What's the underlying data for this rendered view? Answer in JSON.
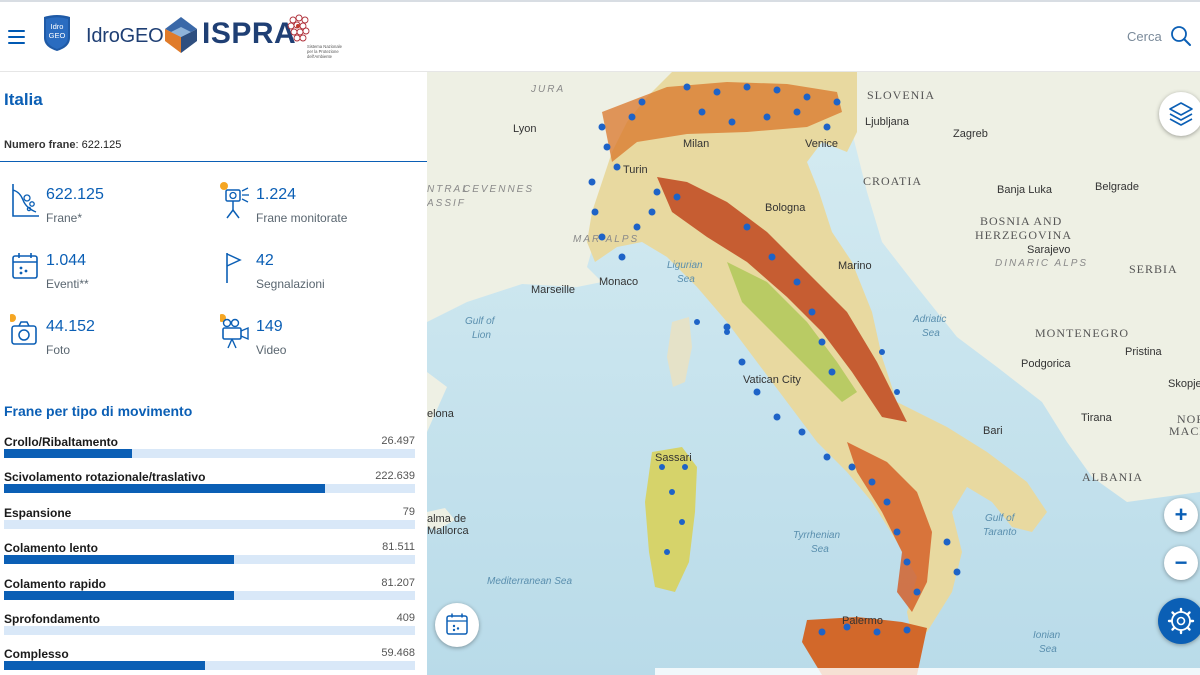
{
  "header": {
    "app_logo_text": "Idro GEO",
    "app_name": "IdroGEO",
    "org_name": "ISPRA",
    "snpa_text": "Sistema Nazionale per la Protezione dell'Ambiente",
    "search_label": "Cerca"
  },
  "panel": {
    "region_title": "Italia",
    "num_frane_label": "Numero frane",
    "num_frane_value": ": 622.125",
    "stats": [
      {
        "value": "622.125",
        "label": "Frane*",
        "icon": "landslide-icon"
      },
      {
        "value": "1.224",
        "label": "Frane monitorate",
        "icon": "monitoring-camera-icon"
      },
      {
        "value": "1.044",
        "label": "Eventi**",
        "icon": "calendar-icon"
      },
      {
        "value": "42",
        "label": "Segnalazioni",
        "icon": "flag-icon"
      },
      {
        "value": "44.152",
        "label": "Foto",
        "icon": "photo-camera-icon"
      },
      {
        "value": "149",
        "label": "Video",
        "icon": "video-camera-icon"
      }
    ],
    "section_title": "Frane per tipo di movimento",
    "movement_types": [
      {
        "label": "Crollo/Ribaltamento",
        "value": "26.497",
        "fraction": 0.311
      },
      {
        "label": "Scivolamento rotazionale/traslativo",
        "value": "222.639",
        "fraction": 0.78
      },
      {
        "label": "Espansione",
        "value": "79",
        "fraction": 0.0
      },
      {
        "label": "Colamento lento",
        "value": "81.511",
        "fraction": 0.56
      },
      {
        "label": "Colamento rapido",
        "value": "81.207",
        "fraction": 0.56
      },
      {
        "label": "Sprofondamento",
        "value": "409",
        "fraction": 0.0
      },
      {
        "label": "Complesso",
        "value": "59.468",
        "fraction": 0.49
      }
    ]
  },
  "map": {
    "labels": {
      "slovenia": "SLOVENIA",
      "ljubljana": "Ljubljana",
      "zagreb": "Zagreb",
      "croatia": "CROATIA",
      "banja_luka": "Banja Luka",
      "belgrade": "Belgrade",
      "bosnia": "BOSNIA AND",
      "herzegovina": "HERZEGOVINA",
      "sarajevo": "Sarajevo",
      "serbia": "SERBIA",
      "dinaric_alps": "DINARIC ALPS",
      "montenegro": "MONTENEGRO",
      "podgorica": "Podgorica",
      "pristina": "Pristina",
      "skopje": "Skopje",
      "north_macedonia_1": "NORTH",
      "north_macedonia_2": "MACEDON",
      "tirana": "Tirana",
      "albania": "ALBANIA",
      "lyon": "Lyon",
      "milan": "Milan",
      "venice": "Venice",
      "turin": "Turin",
      "bologna": "Bologna",
      "marino": "Marino",
      "marseille": "Marseille",
      "monaco": "Monaco",
      "ligurian_sea_1": "Ligurian",
      "ligurian_sea_2": "Sea",
      "adriatic_sea_1": "Adriatic",
      "adriatic_sea_2": "Sea",
      "gulf_lion_1": "Gulf of",
      "gulf_lion_2": "Lion",
      "vatican": "Vatican City",
      "bari": "Bari",
      "celona": "elona",
      "sassari": "Sassari",
      "palma_1": "alma de",
      "palma_2": "Mallorca",
      "tyrrhenian_1": "Tyrrhenian",
      "tyrrhenian_2": "Sea",
      "gulf_taranto_1": "Gulf of",
      "gulf_taranto_2": "Taranto",
      "mediterranean": "Mediterranean Sea",
      "palermo": "Palermo",
      "ionian_1": "Ionian",
      "ionian_2": "Sea",
      "jura": "JURA",
      "cevennes": "CEVENNES",
      "massif_1": "NTRAL",
      "massif_2": "ASSIF",
      "maritime_alps": "MAR ALPS"
    },
    "zoom_in": "+",
    "zoom_out": "−"
  },
  "colors": {
    "primary": "#0b5fb5",
    "bar_track": "#d9e8f8",
    "accent_orange": "#f5a623"
  }
}
